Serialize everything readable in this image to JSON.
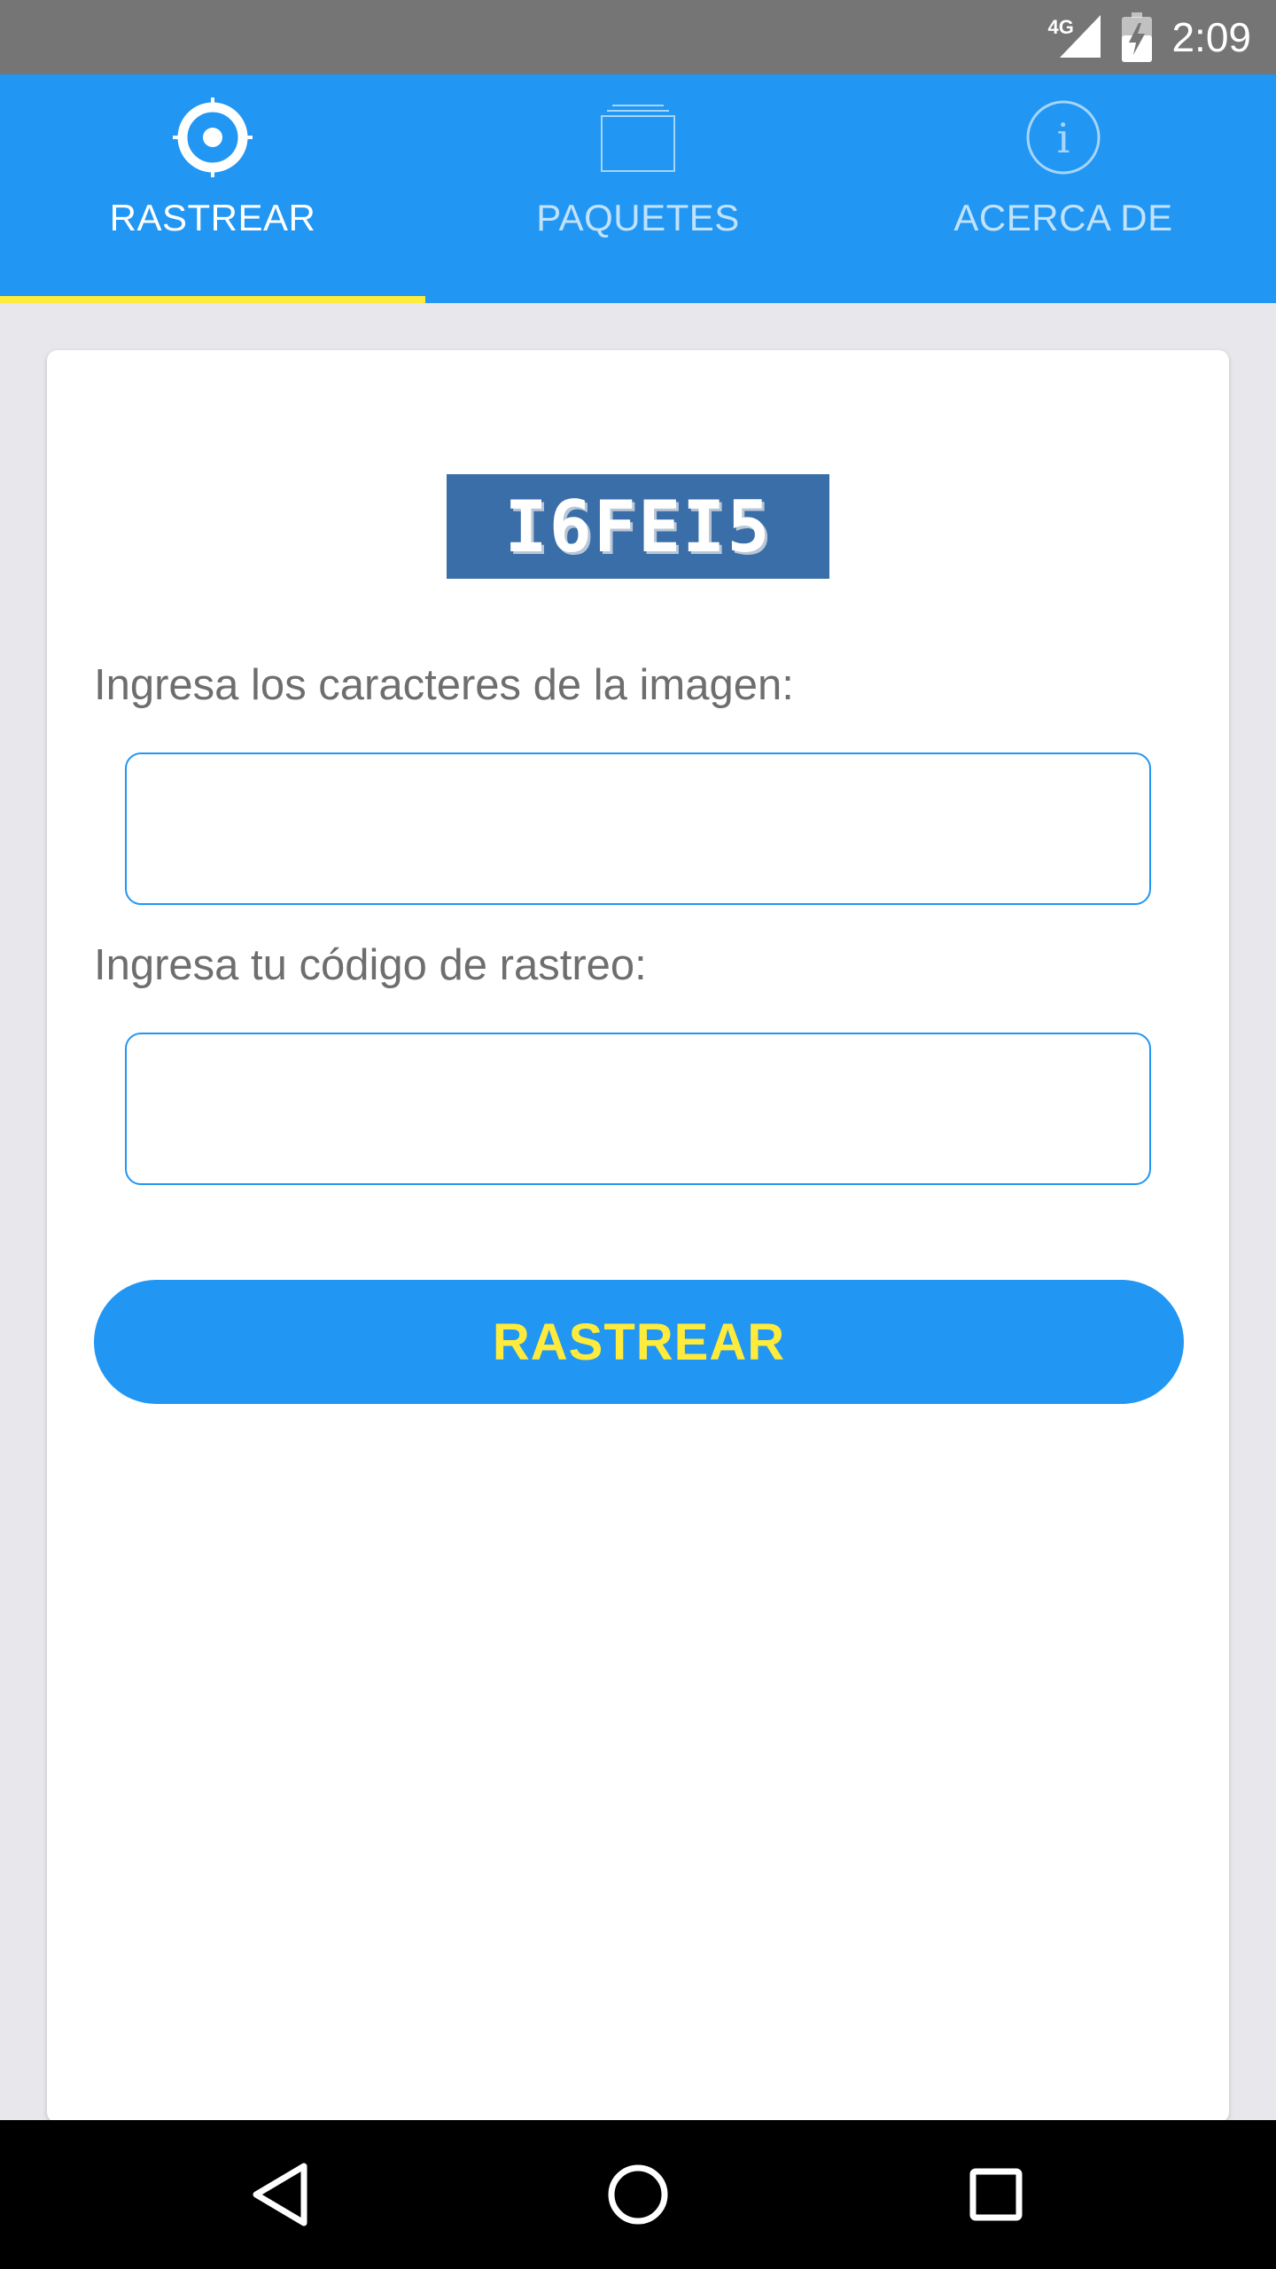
{
  "status_bar": {
    "network_label": "4G",
    "time": "2:09",
    "icons": [
      "signal-icon",
      "battery-charging-icon"
    ]
  },
  "tabs": [
    {
      "label": "RASTREAR",
      "icon": "crosshair-icon",
      "active": true
    },
    {
      "label": "PAQUETES",
      "icon": "package-stack-icon",
      "active": false
    },
    {
      "label": "ACERCA DE",
      "icon": "info-icon",
      "active": false
    }
  ],
  "form": {
    "captcha_text": "I6FEI5",
    "captcha_label": "Ingresa los caracteres de la imagen:",
    "captcha_value": "",
    "tracking_label": "Ingresa tu código de rastreo:",
    "tracking_value": "",
    "submit_label": "RASTREAR"
  },
  "navigation": {
    "icons": [
      "back-icon",
      "home-icon",
      "recents-icon"
    ]
  },
  "colors": {
    "primary": "#2196F3",
    "accent": "#FFEB3B",
    "status_bar": "#757575",
    "label_text": "#6e6e6e",
    "captcha_bg": "#3a6ea8"
  }
}
